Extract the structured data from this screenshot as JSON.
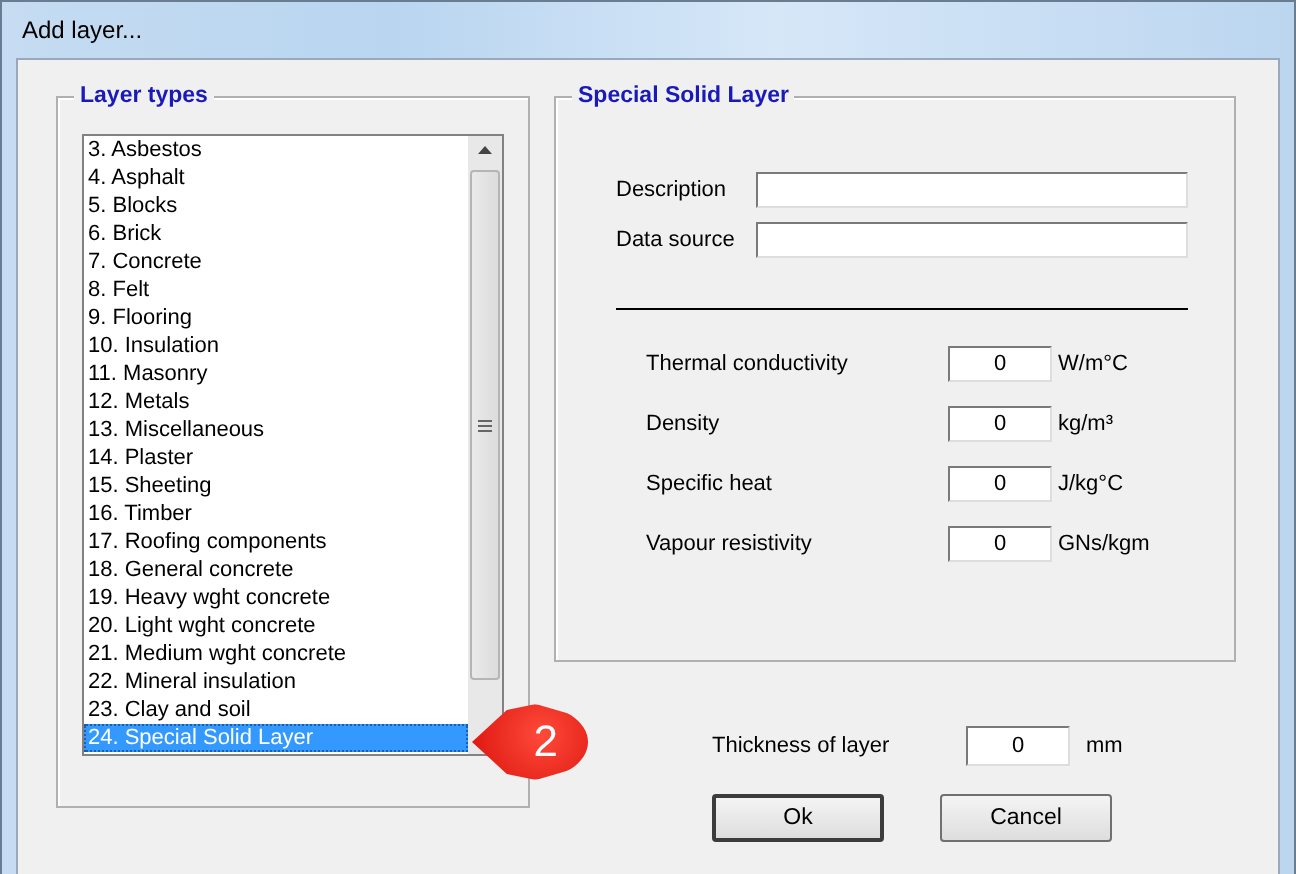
{
  "window": {
    "title": "Add layer..."
  },
  "layer_types": {
    "title": "Layer types",
    "items": [
      {
        "label": "3. Asbestos",
        "selected": false
      },
      {
        "label": "4. Asphalt",
        "selected": false
      },
      {
        "label": "5. Blocks",
        "selected": false
      },
      {
        "label": "6. Brick",
        "selected": false
      },
      {
        "label": "7. Concrete",
        "selected": false
      },
      {
        "label": "8. Felt",
        "selected": false
      },
      {
        "label": "9. Flooring",
        "selected": false
      },
      {
        "label": "10. Insulation",
        "selected": false
      },
      {
        "label": "11. Masonry",
        "selected": false
      },
      {
        "label": "12. Metals",
        "selected": false
      },
      {
        "label": "13. Miscellaneous",
        "selected": false
      },
      {
        "label": "14. Plaster",
        "selected": false
      },
      {
        "label": "15. Sheeting",
        "selected": false
      },
      {
        "label": "16. Timber",
        "selected": false
      },
      {
        "label": "17. Roofing components",
        "selected": false
      },
      {
        "label": "18. General concrete",
        "selected": false
      },
      {
        "label": "19. Heavy wght concrete",
        "selected": false
      },
      {
        "label": "20. Light wght concrete",
        "selected": false
      },
      {
        "label": "21. Medium wght concrete",
        "selected": false
      },
      {
        "label": "22. Mineral insulation",
        "selected": false
      },
      {
        "label": "23. Clay and soil",
        "selected": false
      },
      {
        "label": "24. Special Solid Layer",
        "selected": true
      }
    ]
  },
  "callout": {
    "text": "2"
  },
  "layer": {
    "title": "Special Solid Layer",
    "text_fields": [
      {
        "label": "Description"
      },
      {
        "label": "Data source"
      }
    ],
    "properties": [
      {
        "label": "Thermal conductivity",
        "value": "0",
        "unit": "W/m°C"
      },
      {
        "label": "Density",
        "value": "0",
        "unit": "kg/m³"
      },
      {
        "label": "Specific heat",
        "value": "0",
        "unit": "J/kg°C"
      },
      {
        "label": "Vapour resistivity",
        "value": "0",
        "unit": "GNs/kgm"
      }
    ]
  },
  "thickness": {
    "label": "Thickness of layer",
    "value": "0",
    "unit": "mm"
  },
  "buttons": [
    {
      "label": "Ok",
      "default": true
    },
    {
      "label": "Cancel",
      "default": false
    }
  ]
}
